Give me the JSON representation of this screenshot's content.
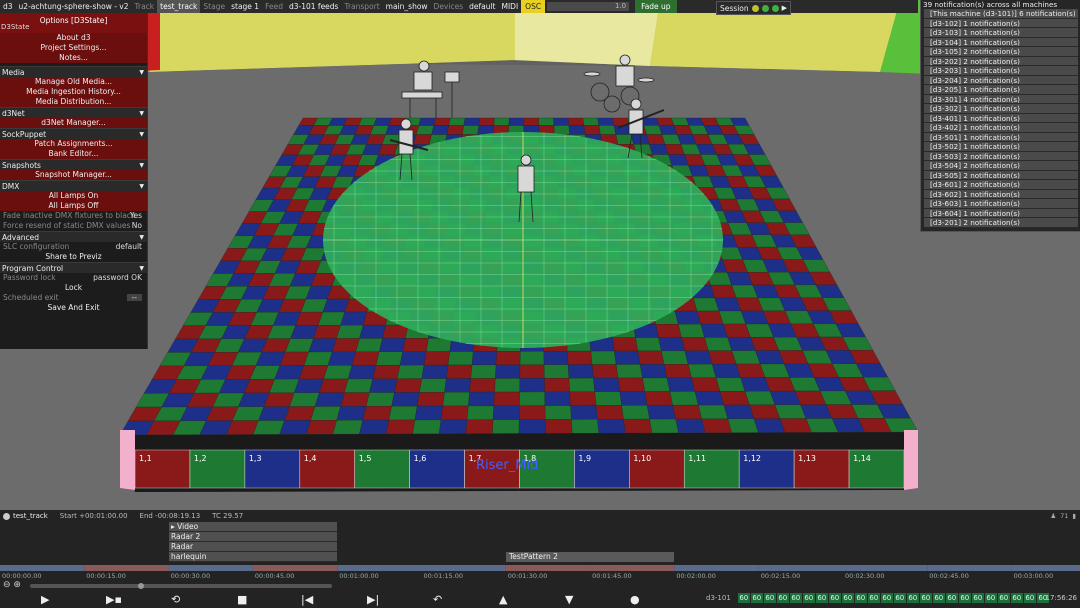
{
  "topbar": {
    "app": "d3",
    "project": "u2-achtung-sphere-show - v2",
    "track_label": "Track",
    "track": "test_track",
    "stage_label": "Stage",
    "stage": "stage 1",
    "feed_label": "Feed",
    "feed": "d3-101 feeds",
    "transport_label": "Transport",
    "transport": "main_show",
    "devices_label": "Devices",
    "devices": "default",
    "midi": "MIDI",
    "osc": "OSC",
    "slider_value": "1.0",
    "fade_up": "Fade up"
  },
  "session": {
    "label": "Session"
  },
  "options": {
    "title": "Options [D3State]",
    "subtitle": "D3State",
    "top_items": [
      "About d3",
      "Project Settings...",
      "Notes..."
    ],
    "sections": [
      {
        "name": "Media",
        "items": [
          "Manage Old Media...",
          "Media Ingestion History...",
          "Media Distribution..."
        ]
      },
      {
        "name": "d3Net",
        "items": [
          "d3Net Manager..."
        ]
      },
      {
        "name": "SockPuppet",
        "items": [
          "Patch Assignments...",
          "Bank Editor..."
        ]
      },
      {
        "name": "Snapshots",
        "items": [
          "Snapshot Manager..."
        ]
      }
    ],
    "dmx": {
      "name": "DMX",
      "items": [
        "All Lamps On",
        "All Lamps Off"
      ],
      "fade_label": "Fade inactive DMX fixtures to black",
      "fade_value": "Yes",
      "resend_label": "Force resend of static DMX values",
      "resend_value": "No"
    },
    "advanced": {
      "name": "Advanced",
      "slc_label": "SLC configuration",
      "slc_value": "default",
      "share": "Share to Previz"
    },
    "program": {
      "name": "Program Control",
      "pw_label": "Password lock",
      "pw_value": "password",
      "pw_ok": "OK",
      "lock": "Lock",
      "exit_label": "Scheduled exit",
      "exit_value": "--",
      "save_exit": "Save And Exit"
    }
  },
  "notifications": {
    "header": "39 notification(s) across all machines",
    "items": [
      "[This machine (d3-101)] 6 notification(s)",
      "[d3-102] 1 notification(s)",
      "[d3-103] 1 notification(s)",
      "[d3-104] 1 notification(s)",
      "[d3-105] 2 notification(s)",
      "[d3-202] 2 notification(s)",
      "[d3-203] 1 notification(s)",
      "[d3-204] 2 notification(s)",
      "[d3-205] 1 notification(s)",
      "[d3-301] 4 notification(s)",
      "[d3-302] 1 notification(s)",
      "[d3-401] 1 notification(s)",
      "[d3-402] 1 notification(s)",
      "[d3-501] 1 notification(s)",
      "[d3-502] 1 notification(s)",
      "[d3-503] 2 notification(s)",
      "[d3-504] 2 notification(s)",
      "[d3-505] 2 notification(s)",
      "[d3-601] 2 notification(s)",
      "[d3-602] 1 notification(s)",
      "[d3-603] 1 notification(s)",
      "[d3-604] 1 notification(s)",
      "[d3-201] 2 notification(s)"
    ]
  },
  "stage": {
    "riser_label": "Riser_Mid",
    "front_labels": [
      "1,1",
      "1,2",
      "1,3",
      "1,4",
      "1,5",
      "1,6",
      "1,7",
      "1,8",
      "1,9",
      "1,10",
      "1,11",
      "1,12",
      "1,13",
      "1,14"
    ],
    "colors": {
      "red": "#8a1a1a",
      "green": "#1e7a32",
      "blue": "#1e2f8a",
      "disc": "#2fae5a"
    }
  },
  "timeline": {
    "track": "test_track",
    "start": "Start +00:01:00.00",
    "end": "End -00:08:19.13",
    "tc": "TC 29.57",
    "right_info": "71",
    "layers": [
      "▸ Video",
      "Radar 2",
      "Radar",
      "harlequin"
    ],
    "clip": "TestPattern 2",
    "ruler": [
      "00:00:00.00",
      "00:00:15.00",
      "00:00:30.00",
      "00:00:45.00",
      "00:01:00.00",
      "00:01:15.00",
      "00:01:30.00",
      "00:01:45.00",
      "00:02:00.00",
      "00:02:15.00",
      "00:02:30.00",
      "00:02:45.00",
      "00:03:00.00"
    ],
    "machine": "d3-101",
    "meter_values": [
      "60",
      "60",
      "60",
      "60",
      "60",
      "60",
      "60",
      "60",
      "60",
      "60",
      "60",
      "60",
      "60",
      "60",
      "60",
      "60",
      "60",
      "60",
      "60",
      "60",
      "60",
      "60",
      "60",
      "60"
    ],
    "clock": "17:56:26"
  }
}
